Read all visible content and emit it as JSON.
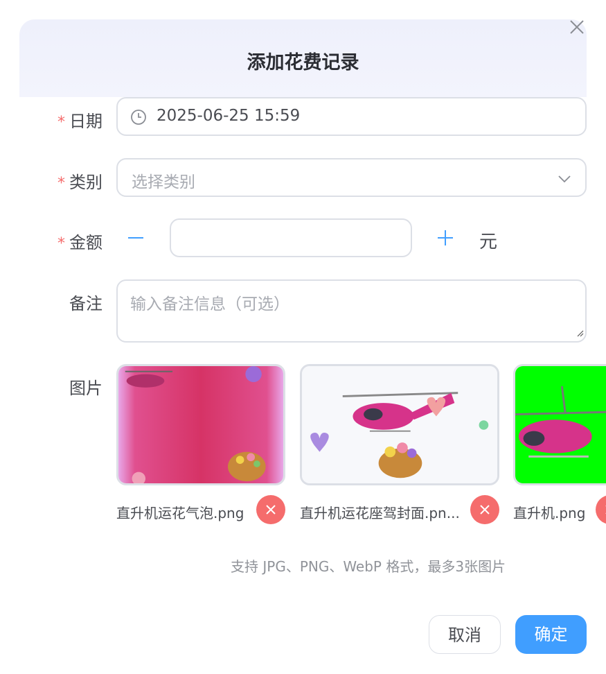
{
  "dialog": {
    "title": "添加花费记录",
    "close_icon": "close-icon"
  },
  "form": {
    "date": {
      "label": "日期",
      "required_mark": "*",
      "value": "2025-06-25 15:59",
      "icon": "clock-icon"
    },
    "category": {
      "label": "类别",
      "required_mark": "*",
      "placeholder": "选择类别",
      "icon": "chevron-down-icon"
    },
    "amount": {
      "label": "金额",
      "required_mark": "*",
      "value": "",
      "unit": "元",
      "minus_icon": "minus-icon",
      "plus_icon": "plus-icon"
    },
    "remark": {
      "label": "备注",
      "placeholder": "输入备注信息（可选）"
    },
    "images": {
      "label": "图片",
      "files": [
        {
          "name": "直升机运花气泡.png"
        },
        {
          "name": "直升机运花座驾封面.pn..."
        },
        {
          "name": "直升机.png"
        }
      ],
      "hint": "支持 JPG、PNG、WebP 格式，最多3张图片"
    }
  },
  "footer": {
    "cancel_label": "取消",
    "confirm_label": "确定"
  },
  "colors": {
    "accent": "#409eff",
    "danger": "#f56c6c",
    "required": "#f56c6c",
    "header_bg": "#eef0fb"
  }
}
